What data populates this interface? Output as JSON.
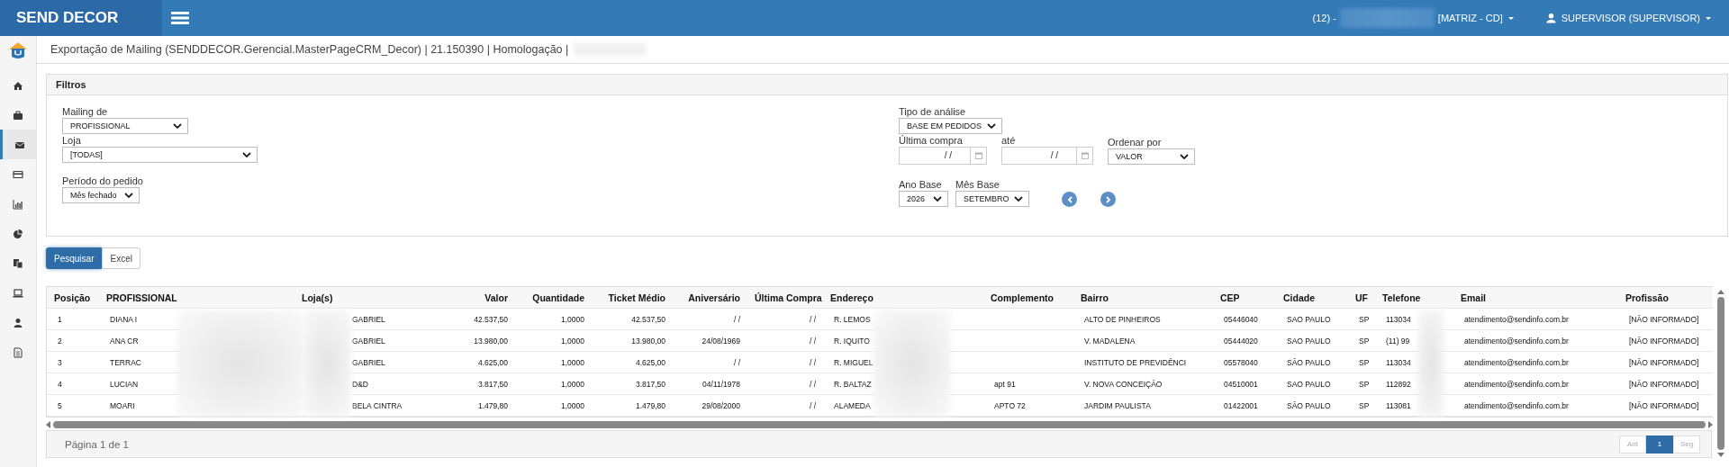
{
  "topbar": {
    "brand": "SEND DECOR",
    "company_prefix": "(12) -",
    "branch": "[MATRIZ - CD]",
    "user": "SUPERVISOR (SUPERVISOR)"
  },
  "sidebar": {
    "items": [
      {
        "kind": "home",
        "selected": false
      },
      {
        "kind": "briefcase",
        "selected": false
      },
      {
        "kind": "envelope",
        "selected": true
      },
      {
        "kind": "card",
        "selected": false
      },
      {
        "kind": "bars",
        "selected": false
      },
      {
        "kind": "pie",
        "selected": false
      },
      {
        "kind": "copy",
        "selected": false
      },
      {
        "kind": "laptop",
        "selected": false
      },
      {
        "kind": "user",
        "selected": false
      },
      {
        "kind": "document",
        "selected": false
      }
    ]
  },
  "page_title": "Exportação de Mailing (SENDDECOR.Gerencial.MasterPageCRM_Decor) | 21.150390 | Homologação |",
  "filters": {
    "title": "Filtros",
    "mailing_de": {
      "label": "Mailing de",
      "value": "PROFISSIONAL"
    },
    "loja": {
      "label": "Loja",
      "value": "[TODAS]"
    },
    "periodo": {
      "label": "Período do pedido",
      "value": "Mês fechado"
    },
    "tipo_analise": {
      "label": "Tipo de análise",
      "value": "BASE EM PEDIDOS"
    },
    "ultima_compra": {
      "label": "Última compra",
      "value": "/ /"
    },
    "ate": {
      "label": "até",
      "value": "/ /"
    },
    "ordenar_por": {
      "label": "Ordenar por",
      "value": "VALOR"
    },
    "ano_base": {
      "label": "Ano Base",
      "value": "2026"
    },
    "mes_base": {
      "label": "Mês Base",
      "value": "SETEMBRO"
    }
  },
  "buttons": [
    {
      "label": "Pesquisar",
      "selected": true
    },
    {
      "label": "Excel",
      "selected": false
    }
  ],
  "table": {
    "columns": [
      "Posição",
      "PROFISSIONAL",
      "Loja(s)",
      "Valor",
      "Quantidade",
      "Ticket Médio",
      "Aniversário",
      "Última Compra",
      "Endereço",
      "Complemento",
      "Bairro",
      "CEP",
      "Cidade",
      "UF",
      "Telefone",
      "Email",
      "Profissão"
    ],
    "rows": [
      {
        "posicao": "1",
        "profissional": "DIANA I",
        "loja": "GABRIEL",
        "valor": "42.537,50",
        "quantidade": "1,0000",
        "ticket_medio": "42.537,50",
        "aniversario": "/ /",
        "ultima_compra": "/ /",
        "endereco": "R. LEMOS",
        "bairro": "ALTO DE PINHEIROS",
        "cep": "05446040",
        "cidade": "SAO PAULO",
        "uf": "SP",
        "telefone": "113034",
        "email": "atendimento@sendinfo.com.br",
        "profissao": "[NÃO INFORMADO]"
      },
      {
        "posicao": "2",
        "profissional": "ANA CR",
        "loja": "GABRIEL",
        "valor": "13.980,00",
        "quantidade": "1,0000",
        "ticket_medio": "13.980,00",
        "aniversario": "24/08/1969",
        "ultima_compra": "/ /",
        "endereco": "R. IQUITO",
        "bairro": "V. MADALENA",
        "cep": "05444020",
        "cidade": "SAO PAULO",
        "uf": "SP",
        "telefone": "(11) 99",
        "email": "atendimento@sendinfo.com.br",
        "profissao": "[NÃO INFORMADO]"
      },
      {
        "posicao": "3",
        "profissional": "TERRAC",
        "loja": "GABRIEL",
        "valor": "4.625,00",
        "quantidade": "1,0000",
        "ticket_medio": "4.625,00",
        "aniversario": "/ /",
        "ultima_compra": "/ /",
        "endereco": "R. MIGUEL",
        "bairro": "INSTITUTO DE PREVIDÊNCI",
        "cep": "05578040",
        "cidade": "SÃO PAULO",
        "uf": "SP",
        "telefone": "113034",
        "email": "atendimento@sendinfo.com.br",
        "profissao": "[NÃO INFORMADO]"
      },
      {
        "posicao": "4",
        "profissional": "LUCIAN",
        "loja": "D&D",
        "valor": "3.817,50",
        "quantidade": "1,0000",
        "ticket_medio": "3.817,50",
        "aniversario": "04/11/1978",
        "ultima_compra": "/ /",
        "endereco": "R. BALTAZ",
        "complemento": "apt 91",
        "bairro": "V. NOVA CONCEIÇÃO",
        "cep": "04510001",
        "cidade": "SAO PAULO",
        "uf": "SP",
        "telefone": "112892",
        "email": "atendimento@sendinfo.com.br",
        "profissao": "[NÃO INFORMADO]"
      },
      {
        "posicao": "5",
        "profissional": "MOARI",
        "loja": "BELA CINTRA",
        "valor": "1.479,80",
        "quantidade": "1,0000",
        "ticket_medio": "1.479,80",
        "aniversario": "29/08/2000",
        "ultima_compra": "/ /",
        "endereco": "ALAMEDA",
        "complemento": "APTO 72",
        "bairro": "JARDIM PAULISTA",
        "cep": "01422001",
        "cidade": "SÃO PAULO",
        "uf": "SP",
        "telefone": "113081",
        "email": "atendimento@sendinfo.com.br",
        "profissao": "[NÃO INFORMADO]"
      }
    ]
  },
  "pager": {
    "text": "Página 1 de 1",
    "buttons": [
      {
        "label": "Ant",
        "selected": false,
        "disabled": true
      },
      {
        "label": "1",
        "selected": true,
        "disabled": false
      },
      {
        "label": "Seg",
        "selected": false,
        "disabled": true
      }
    ]
  }
}
